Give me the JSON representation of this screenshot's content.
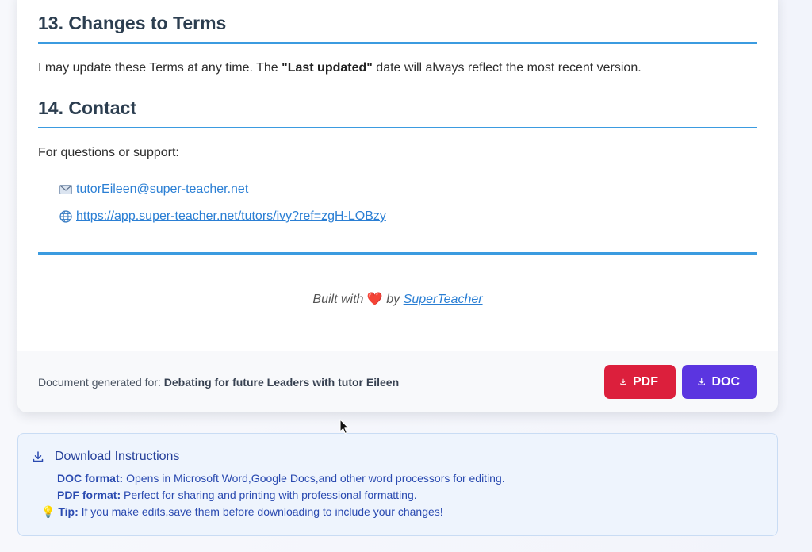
{
  "terms": {
    "section13": {
      "heading": "13. Changes to Terms",
      "text_before": "I may update these Terms at any time. The ",
      "text_bold": "\"Last updated\"",
      "text_after": " date will always reflect the most recent version."
    },
    "section14": {
      "heading": "14. Contact",
      "intro": "For questions or support:",
      "email_icon": "email-icon",
      "email": "tutorEileen@super-teacher.net",
      "web_icon": "globe-icon",
      "url": "https://app.super-teacher.net/tutors/ivy?ref=zgH-LOBzy"
    }
  },
  "built": {
    "prefix": "Built with",
    "heart": "❤️",
    "by": "by",
    "brand": "SuperTeacher"
  },
  "footer": {
    "generated_label": "Document generated for:",
    "generated_for": "Debating for future Leaders with tutor Eileen",
    "pdf_label": "PDF",
    "doc_label": "DOC"
  },
  "instructions": {
    "title": "Download Instructions",
    "doc_label": "DOC format:",
    "doc_text": " Opens in Microsoft Word,Google Docs,and other word processors for editing.",
    "pdf_label": "PDF format:",
    "pdf_text": " Perfect for sharing and printing with professional formatting.",
    "tip_icon": "💡",
    "tip_label": "Tip:",
    "tip_text": " If you make edits,save them before downloading to include your changes!"
  },
  "colors": {
    "accent_blue": "#3b9be0",
    "pdf_red": "#dc1f3c",
    "doc_purple": "#5b35e0",
    "link_blue": "#2b7fd4"
  }
}
